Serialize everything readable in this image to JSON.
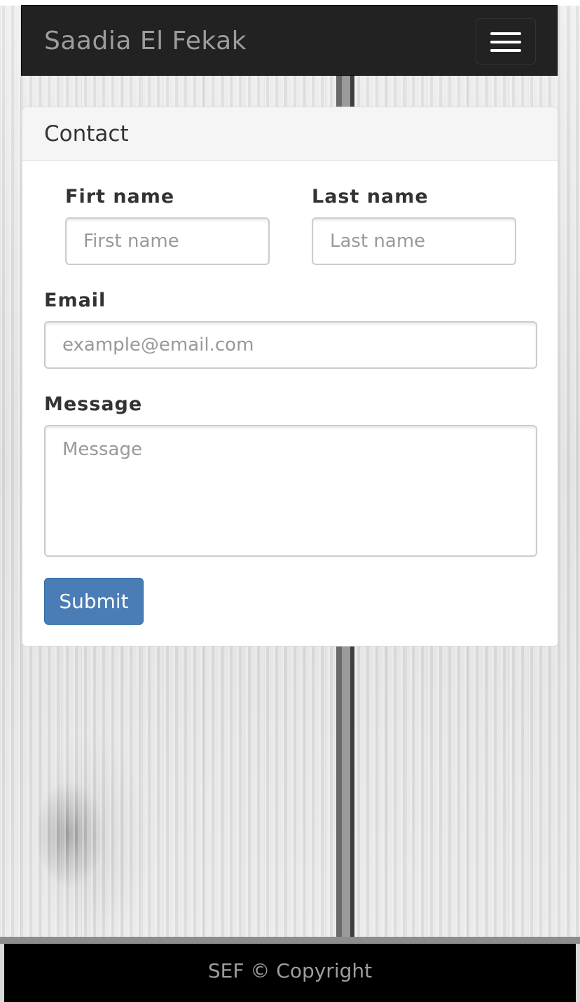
{
  "navbar": {
    "brand": "Saadia El Fekak",
    "menu_icon": "hamburger-menu-icon"
  },
  "panel": {
    "title": "Contact"
  },
  "form": {
    "first_name_label": "Firt name",
    "first_name_placeholder": "First name",
    "first_name_value": "",
    "last_name_label": "Last name",
    "last_name_placeholder": "Last name",
    "last_name_value": "",
    "email_label": "Email",
    "email_placeholder": "example@email.com",
    "email_value": "",
    "message_label": "Message",
    "message_placeholder": "Message",
    "message_value": "",
    "submit_label": "Submit"
  },
  "footer": {
    "text": "SEF © Copyright"
  },
  "colors": {
    "navbar_bg": "#222222",
    "brand_text": "#9d9d9d",
    "submit_bg": "#4a7db5",
    "footer_bg": "#000000"
  }
}
